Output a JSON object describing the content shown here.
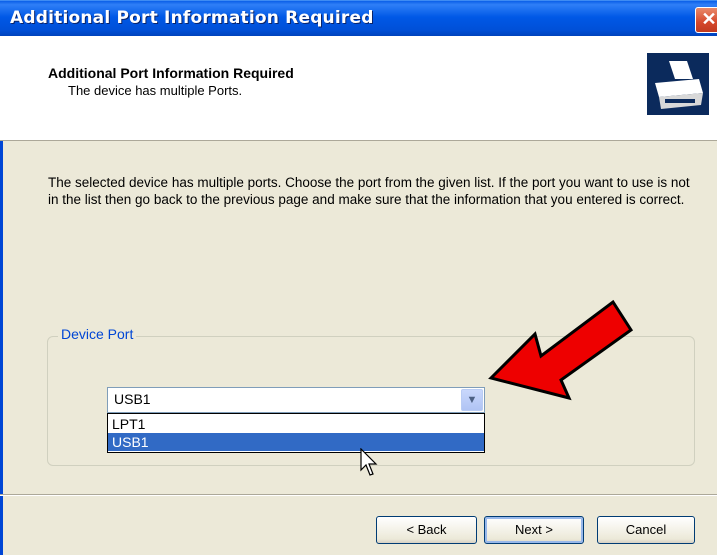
{
  "window": {
    "title": "Additional Port Information Required",
    "close_glyph": "✕"
  },
  "header": {
    "title": "Additional Port Information Required",
    "subtitle": "The device has multiple Ports.",
    "icon": "printer-icon"
  },
  "body": {
    "description": "The selected device has multiple ports.  Choose the port from the given list.  If the port you want to use is not in the list then go back to the previous page and make sure that the information that you entered is correct."
  },
  "device_port": {
    "group_label": "Device Port",
    "selected_value": "USB1",
    "options": [
      "LPT1",
      "USB1"
    ],
    "highlighted_index": 1
  },
  "buttons": {
    "back": "< Back",
    "next": "Next >",
    "cancel": "Cancel"
  },
  "colors": {
    "titlebar": "#0054e3",
    "dialog_bg": "#ece9d8",
    "selection": "#316ac5",
    "group_label": "#0046d5",
    "annotation_arrow": "#ee0000"
  }
}
